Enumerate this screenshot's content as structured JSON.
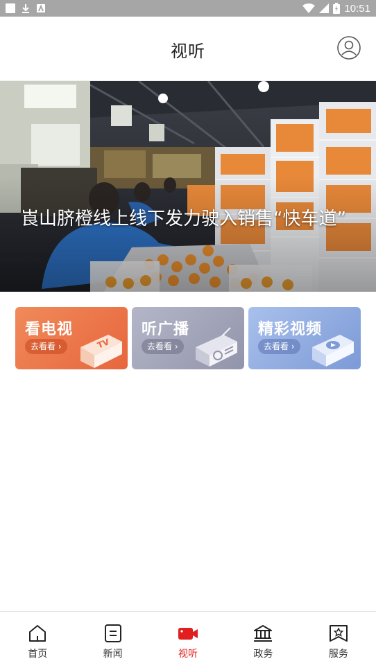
{
  "status_bar": {
    "time": "10:51"
  },
  "header": {
    "title": "视听"
  },
  "hero": {
    "caption": "崀山脐橙线上线下发力驶入销售“快车道”"
  },
  "cards": [
    {
      "title": "看电视",
      "button": "去看看 ›",
      "icon": "tv-icon"
    },
    {
      "title": "听广播",
      "button": "去看看 ›",
      "icon": "radio-icon"
    },
    {
      "title": "精彩视频",
      "button": "去看看 ›",
      "icon": "video-icon"
    }
  ],
  "bottom_nav": {
    "active_color": "#e02020",
    "items": [
      {
        "label": "首页",
        "icon": "home-icon"
      },
      {
        "label": "新闻",
        "icon": "news-icon"
      },
      {
        "label": "视听",
        "icon": "video-camera-icon",
        "active": true
      },
      {
        "label": "政务",
        "icon": "government-icon"
      },
      {
        "label": "服务",
        "icon": "service-icon"
      }
    ]
  }
}
